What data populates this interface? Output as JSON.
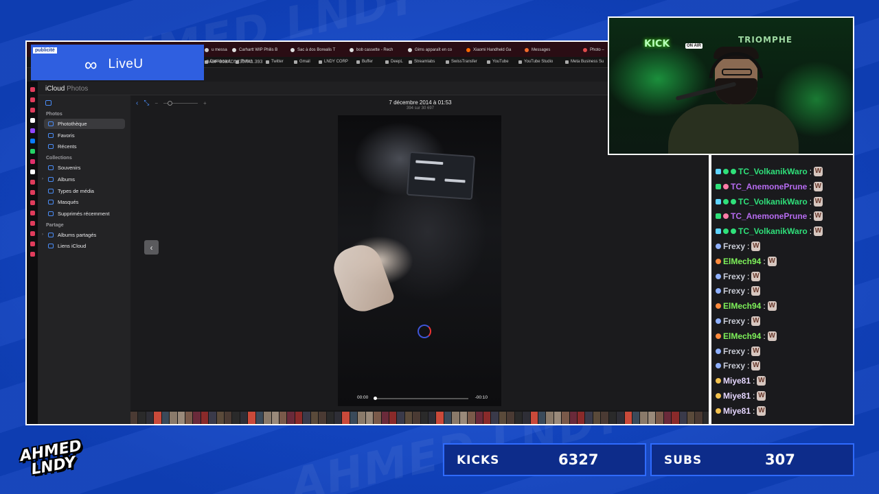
{
  "stream": {
    "stats": [
      {
        "label": "KICKS",
        "value": "6327"
      },
      {
        "label": "SUBS",
        "value": "307"
      }
    ],
    "logo": {
      "line1": "AHMED",
      "line2": "LNDY"
    },
    "background_word": "AHMED LNDY"
  },
  "ad": {
    "tag": "publicité",
    "brand": "LiveU"
  },
  "browser": {
    "tabs": [
      {
        "title": "u messa",
        "color": "#cccccc"
      },
      {
        "title": "Carhartt WIP Philis B",
        "color": "#dddddd"
      },
      {
        "title": "Sac à dos Borealis T",
        "color": "#dddddd"
      },
      {
        "title": "bob cassette - Rech",
        "color": "#dddddd"
      },
      {
        "title": "Gims apparaît en co",
        "color": "#dddddd"
      },
      {
        "title": "Xiaomi Handheld Ga",
        "color": "#ff6900"
      },
      {
        "title": "Messages",
        "color": "#f26b2c"
      },
      {
        "title": "Photo –",
        "color": "#e04b4b"
      }
    ],
    "url_fragment": "-9A8F-369AD57357A1.393",
    "bookmarks": [
      "Dashboard",
      "Twitch",
      "Twitter",
      "Gmail",
      "LNDY CORP",
      "Buffer",
      "DeepL",
      "Streamlabs",
      "SwissTransfer",
      "YouTube",
      "YouTube Studio",
      "Meta Business Su"
    ]
  },
  "icloud": {
    "brand": "iCloud",
    "app": "Photos",
    "sidebar": {
      "sections": [
        {
          "title": "Photos",
          "items": [
            "Photothèque",
            "Favoris",
            "Récents"
          ]
        },
        {
          "title": "Collections",
          "items": [
            "Souvenirs",
            "Albums",
            "Types de média",
            "Masqués",
            "Supprimés récemment"
          ]
        },
        {
          "title": "Partage",
          "items": [
            "Albums partagés",
            "Liens iCloud"
          ]
        }
      ]
    },
    "viewer": {
      "date": "7 décembre 2014 à 01:53",
      "count": "394 sur 30 697",
      "time_current": "00:00",
      "time_remaining": "-00:10",
      "progress": 0.0
    }
  },
  "chat": {
    "messages": [
      {
        "user": "TC_VolkanikWaro",
        "color": "#2fe07a"
      },
      {
        "user": "TC_AnemonePrune",
        "color": "#b66bf0"
      },
      {
        "user": "TC_VolkanikWaro",
        "color": "#2fe07a"
      },
      {
        "user": "TC_AnemonePrune",
        "color": "#b66bf0"
      },
      {
        "user": "TC_VolkanikWaro",
        "color": "#2fe07a"
      },
      {
        "user": "Frexy",
        "color": "#c9ccd6"
      },
      {
        "user": "ElMech94",
        "color": "#7ef25a"
      },
      {
        "user": "Frexy",
        "color": "#c9ccd6"
      },
      {
        "user": "Frexy",
        "color": "#c9ccd6"
      },
      {
        "user": "ElMech94",
        "color": "#7ef25a"
      },
      {
        "user": "Frexy",
        "color": "#c9ccd6"
      },
      {
        "user": "ElMech94",
        "color": "#7ef25a"
      },
      {
        "user": "Frexy",
        "color": "#c9ccd6"
      },
      {
        "user": "Frexy",
        "color": "#c9ccd6"
      },
      {
        "user": "Miye81",
        "color": "#e6d7ff"
      },
      {
        "user": "Miye81",
        "color": "#e6d7ff"
      },
      {
        "user": "Miye81",
        "color": "#e6d7ff"
      }
    ],
    "colon": ":",
    "emote": "W"
  },
  "webcam": {
    "sign_left": "KICK",
    "sign_onair": "ON AIR",
    "sign_right": "TRIOMPHE"
  }
}
